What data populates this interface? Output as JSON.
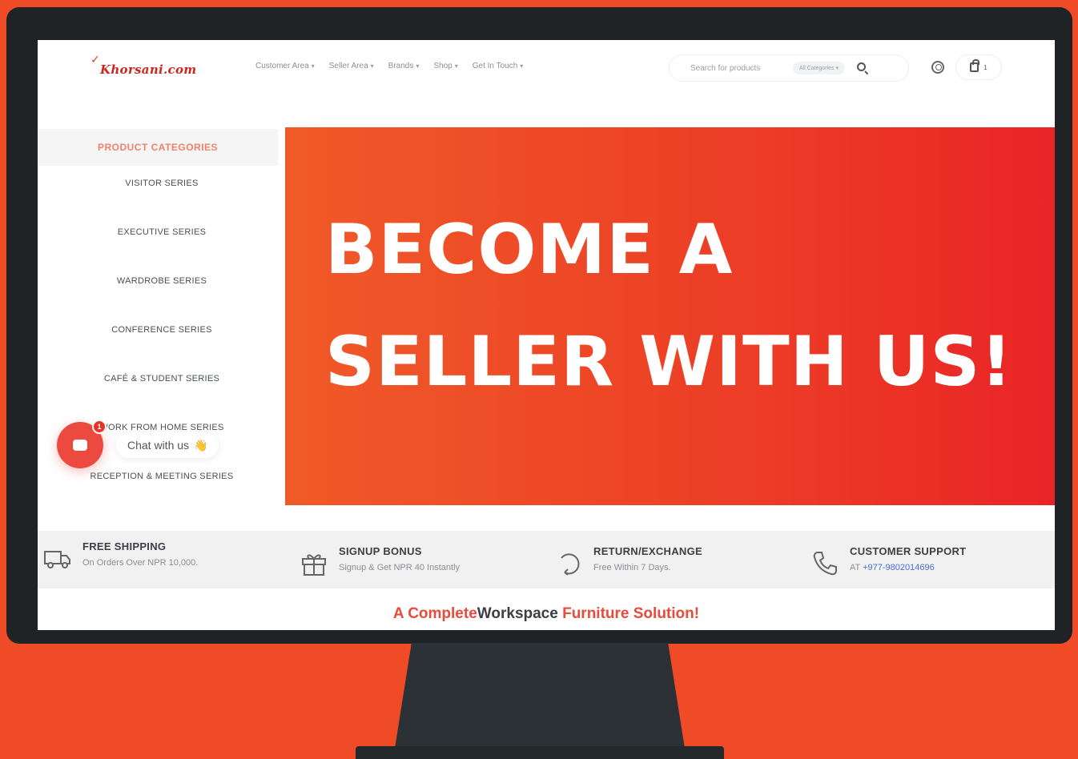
{
  "site": {
    "logo_text": "Khorsani.com"
  },
  "nav": {
    "items": [
      {
        "label": "Customer Area"
      },
      {
        "label": "Seller Area"
      },
      {
        "label": "Brands"
      },
      {
        "label": "Shop"
      },
      {
        "label": "Get In Touch"
      }
    ]
  },
  "search": {
    "placeholder": "Search for products",
    "category": "All Categories"
  },
  "cart": {
    "count": "1"
  },
  "categories": {
    "title": "PRODUCT CATEGORIES",
    "items": [
      {
        "label": "VISITOR SERIES"
      },
      {
        "label": "EXECUTIVE SERIES"
      },
      {
        "label": "WARDROBE SERIES"
      },
      {
        "label": "CONFERENCE SERIES"
      },
      {
        "label": "CAFÉ & STUDENT SERIES"
      },
      {
        "label": "WORK FROM HOME SERIES"
      },
      {
        "label": "RECEPTION & MEETING SERIES"
      }
    ]
  },
  "banner": {
    "line1": "BECOME A",
    "line2": "SELLER WITH US!"
  },
  "chat": {
    "label": "Chat with us",
    "emoji": "👋",
    "badge": "1"
  },
  "features": [
    {
      "title": "FREE SHIPPING",
      "subtitle": "On Orders Over NPR 10,000.",
      "icon": "truck-icon"
    },
    {
      "title": "SIGNUP BONUS",
      "subtitle": "Signup & Get NPR 40 Instantly",
      "icon": "gift-icon"
    },
    {
      "title": "RETURN/EXCHANGE",
      "subtitle": "Free Within 7 Days.",
      "icon": "return-icon"
    },
    {
      "title": "CUSTOMER SUPPORT",
      "subtitle_prefix": "AT",
      "phone": "+977-9802014696",
      "icon": "phone-icon"
    }
  ],
  "tagline": {
    "part1": "A Complete",
    "part2": "Workspace",
    "part3": " Furniture Solution!"
  },
  "colors": {
    "background": "#ef4b27",
    "bezel": "#1f2326",
    "accent": "#e84b3a",
    "banner_start": "#f05a28",
    "banner_end": "#ea2426"
  }
}
